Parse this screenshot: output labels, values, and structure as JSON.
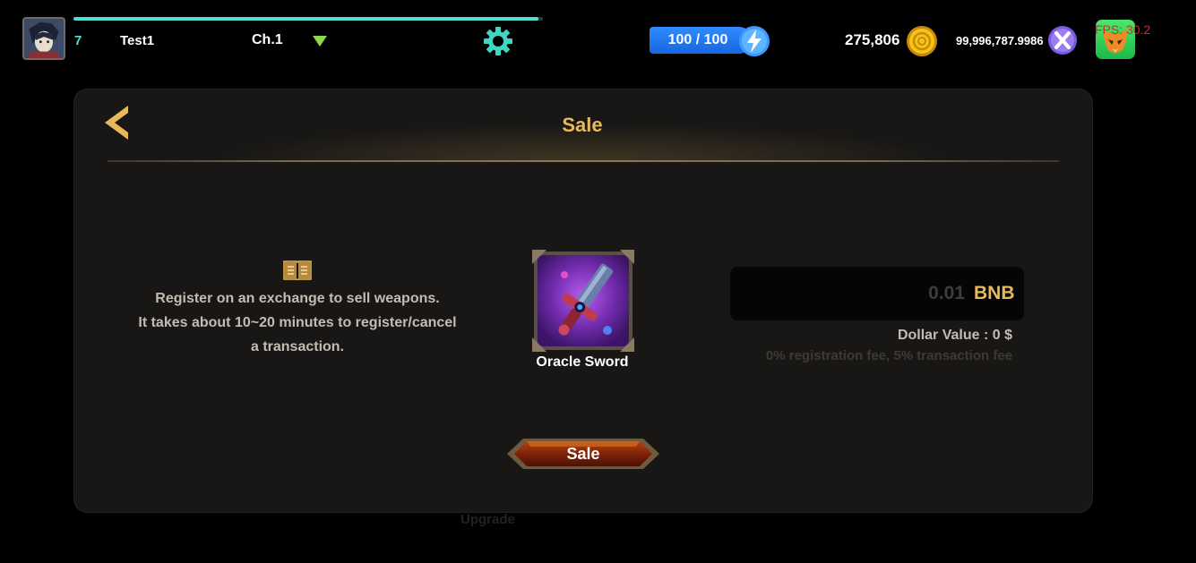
{
  "hud": {
    "level": "7",
    "player_name": "Test1",
    "chapter": "Ch.1",
    "xp_progress": 0.99,
    "energy": "100 / 100",
    "gold": "275,806",
    "token_balance": "99,996,787.9986",
    "fps": "FPS: 30.2"
  },
  "sale": {
    "title": "Sale",
    "info_lines": [
      "Register on an exchange to sell weapons.",
      "It takes about 10~20 minutes to register/cancel",
      "a transaction."
    ],
    "item_name": "Oracle Sword",
    "price_value": "",
    "price_placeholder": "0.01",
    "currency": "BNB",
    "dollar_value": "Dollar Value : 0 $",
    "fee_text": "0% registration fee, 5% transaction fee",
    "sale_button": "Sale"
  },
  "background": {
    "upgrade_label": "Upgrade"
  },
  "colors": {
    "accent_gold": "#e8b95a",
    "xp_teal": "#4fe1cf",
    "energy_blue": "#1f7bf2",
    "fox_green": "#2ccf55"
  }
}
